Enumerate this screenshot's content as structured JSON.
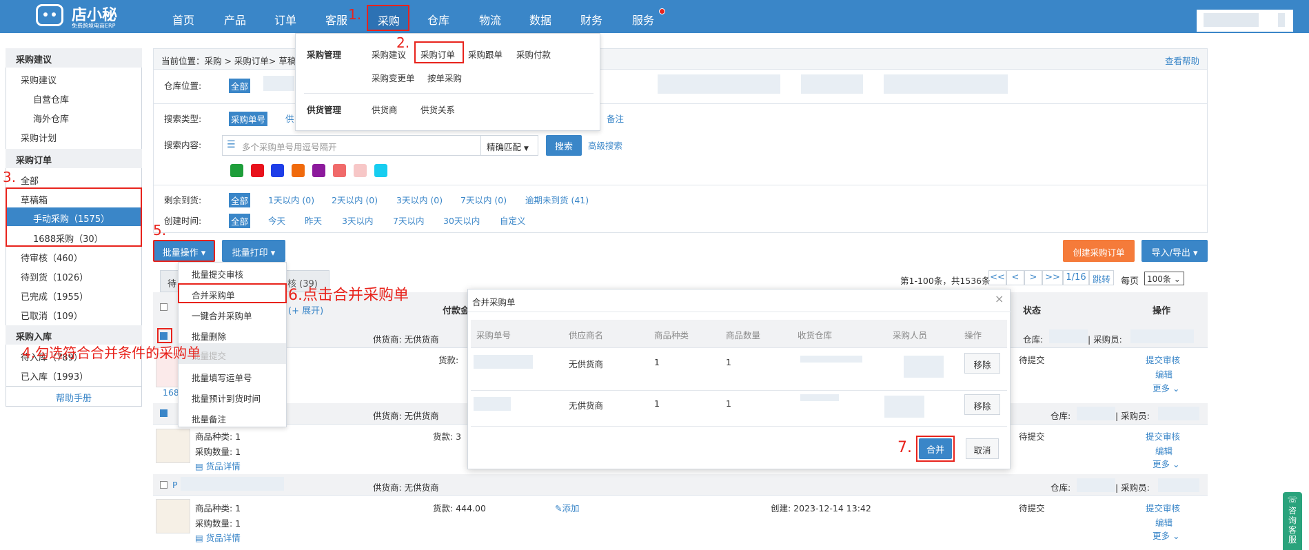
{
  "topnav": {
    "logo_text": "店小秘",
    "logo_sub": "免费跨境电商ERP",
    "items": [
      "首页",
      "产品",
      "订单",
      "客服",
      "采购",
      "仓库",
      "物流",
      "数据",
      "财务",
      "服务"
    ],
    "active": "采购"
  },
  "dropdown": {
    "purchase_mgmt": "采购管理",
    "supply_mgmt": "供货管理",
    "links_row1": [
      "采购建议",
      "采购订单",
      "采购跟单",
      "采购付款"
    ],
    "links_row2": [
      "采购变更单",
      "按单采购"
    ],
    "links_row3": [
      "供货商",
      "供货关系"
    ]
  },
  "sidebar": {
    "sec1": "采购建议",
    "s1_items": [
      "采购建议",
      "自营仓库",
      "海外仓库",
      "采购计划"
    ],
    "sec2": "采购订单",
    "all": "全部",
    "draft": "草稿箱",
    "manual": "手动采购（1575）",
    "p1688": "1688采购（30）",
    "pending_review": "待审核（460）",
    "pending_arrival": "待到货（1026）",
    "done": "已完成（1955）",
    "cancelled": "已取消（109）",
    "sec3": "采购入库",
    "to_store": "待入库（789）",
    "stored": "已入库（1993）",
    "help": "帮助手册"
  },
  "breadcrumb": {
    "text": "当前位置：采购 > 采购订单> 草稿箱",
    "help": "查看帮助"
  },
  "filters": {
    "warehouse_label": "仓库位置:",
    "all": "全部",
    "search_type_label": "搜索类型:",
    "search_type_sel": "采购单号",
    "search_type_more": "供",
    "remark": "备注",
    "search_content_label": "搜索内容:",
    "search_placeholder": "多个采购单号用逗号隔开",
    "match": "精确匹配",
    "search_btn": "搜索",
    "advanced": "高级搜索",
    "remain_label": "剩余到货:",
    "remain_opts": [
      "1天以内 (0)",
      "2天以内 (0)",
      "3天以内 (0)",
      "7天以内 (0)",
      "逾期未到货 (41)"
    ],
    "created_label": "创建时间:",
    "created_opts": [
      "今天",
      "昨天",
      "3天以内",
      "7天以内",
      "30天以内",
      "自定义"
    ],
    "swatches": [
      "#1e9e3a",
      "#e8121c",
      "#1e3ee8",
      "#f06a0c",
      "#8c1a9c",
      "#f06a6a",
      "#f7c7c7",
      "#17cdf0"
    ]
  },
  "toolbar": {
    "batch_op": "批量操作",
    "batch_print": "批量打印",
    "create": "创建采购订单",
    "import_export": "导入/导出"
  },
  "batch_menu": [
    "批量提交审核",
    "合并采购单",
    "一键合并采购单",
    "批量删除",
    "批量提交",
    "批量填写运单号",
    "批量预计到货时间",
    "批量备注"
  ],
  "pager": {
    "info": "第1-100条，共1536条",
    "first": "<<",
    "prev": "<",
    "next": ">",
    "last": ">>",
    "page": "1/16",
    "jump": "跳转",
    "per_page": "每页",
    "per_val": "100条"
  },
  "tabs": {
    "pending": "待",
    "review": "核 (39)"
  },
  "table": {
    "expand": "(+ 展开)",
    "pay": "付款金",
    "status": "状态",
    "ops": "操作"
  },
  "rows": [
    {
      "supplier": "供货商:  无供货商",
      "goods_label": "货款:",
      "status": "待提交",
      "warehouse": "仓库:",
      "buyer": "| 采购员:",
      "op1": "提交审核",
      "op2": "编辑",
      "op3": "更多",
      "id_prefix": "168"
    },
    {
      "supplier": "供货商:  无供货商",
      "kinds": "商品种类:  1",
      "qty": "采购数量:  1",
      "detail": "货品详情",
      "goods": "货款:  3",
      "status": "待提交",
      "warehouse": "仓库:",
      "buyer": "| 采购员:",
      "op1": "提交审核",
      "op2": "编辑",
      "op3": "更多"
    },
    {
      "id_prefix": "P",
      "supplier": "供货商:  无供货商",
      "kinds": "商品种类:  1",
      "qty": "采购数量:  1",
      "detail": "货品详情",
      "goods": "货款:  444.00",
      "add": "添加",
      "created": "创建:  2023-12-14 13:42",
      "status": "待提交",
      "warehouse": "仓库:",
      "buyer": "| 采购员:",
      "op1": "提交审核",
      "op2": "编辑",
      "op3": "更多"
    }
  ],
  "modal": {
    "title": "合并采购单",
    "close": "×",
    "cols": [
      "采购单号",
      "供应商名",
      "商品种类",
      "商品数量",
      "收货仓库",
      "采购人员",
      "操作"
    ],
    "rows": [
      {
        "supplier": "无供货商",
        "kinds": "1",
        "qty": "1",
        "remove": "移除"
      },
      {
        "supplier": "无供货商",
        "kinds": "1",
        "qty": "1",
        "remove": "移除"
      }
    ],
    "merge": "合并",
    "cancel": "取消"
  },
  "annotations": {
    "a1": "1.",
    "a2": "2.",
    "a3": "3.",
    "a4": "4.勾选符合合并条件的采购单",
    "a5": "5.",
    "a6": "6.点击合并采购单",
    "a7": "7."
  },
  "consult": "咨询客服"
}
